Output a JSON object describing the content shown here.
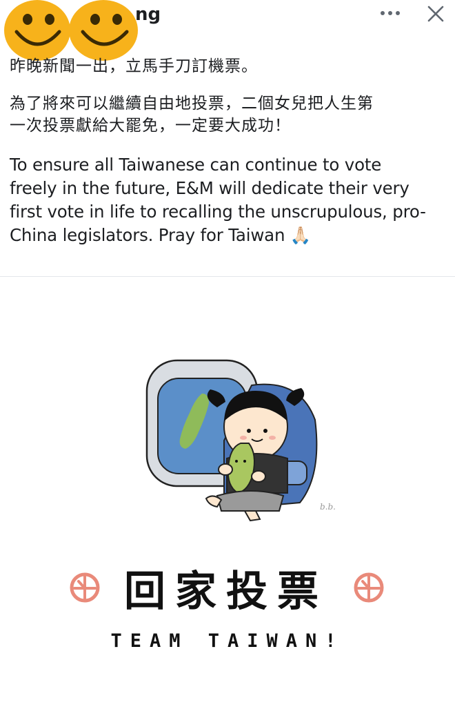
{
  "post": {
    "author_visible_suffix": "ng",
    "paragraph_1": "昨晚新聞一出，立馬手刀訂機票。",
    "paragraph_2_line_1": "為了將來可以繼續自由地投票，二個女兒把人生第",
    "paragraph_2_line_2": "一次投票獻給大罷免，一定要大成功！",
    "paragraph_3_lines": [
      "To ensure all Taiwanese can continue to vote",
      "freely in the future, E&M will dedicate their very",
      "first vote in life to recalling the unscrupulous, pro-",
      "China legislators. Pray for Taiwan 🙏🏻"
    ]
  },
  "image": {
    "caption_zh": "回家投票",
    "caption_en": "TEAM TAIWAN!",
    "artist_signature": "b.b."
  },
  "icons": {
    "more": "more-horizontal-icon",
    "close": "close-icon",
    "emoji": "smiley-face-icon",
    "hands": "folded-hands-emoji"
  },
  "colors": {
    "emoji_yellow": "#f7b21b",
    "window_blue": "#5b8fc9",
    "seat_blue": "#4a74b8",
    "taiwan_green": "#8fbb5a",
    "stamp_red": "#e98a7a"
  }
}
